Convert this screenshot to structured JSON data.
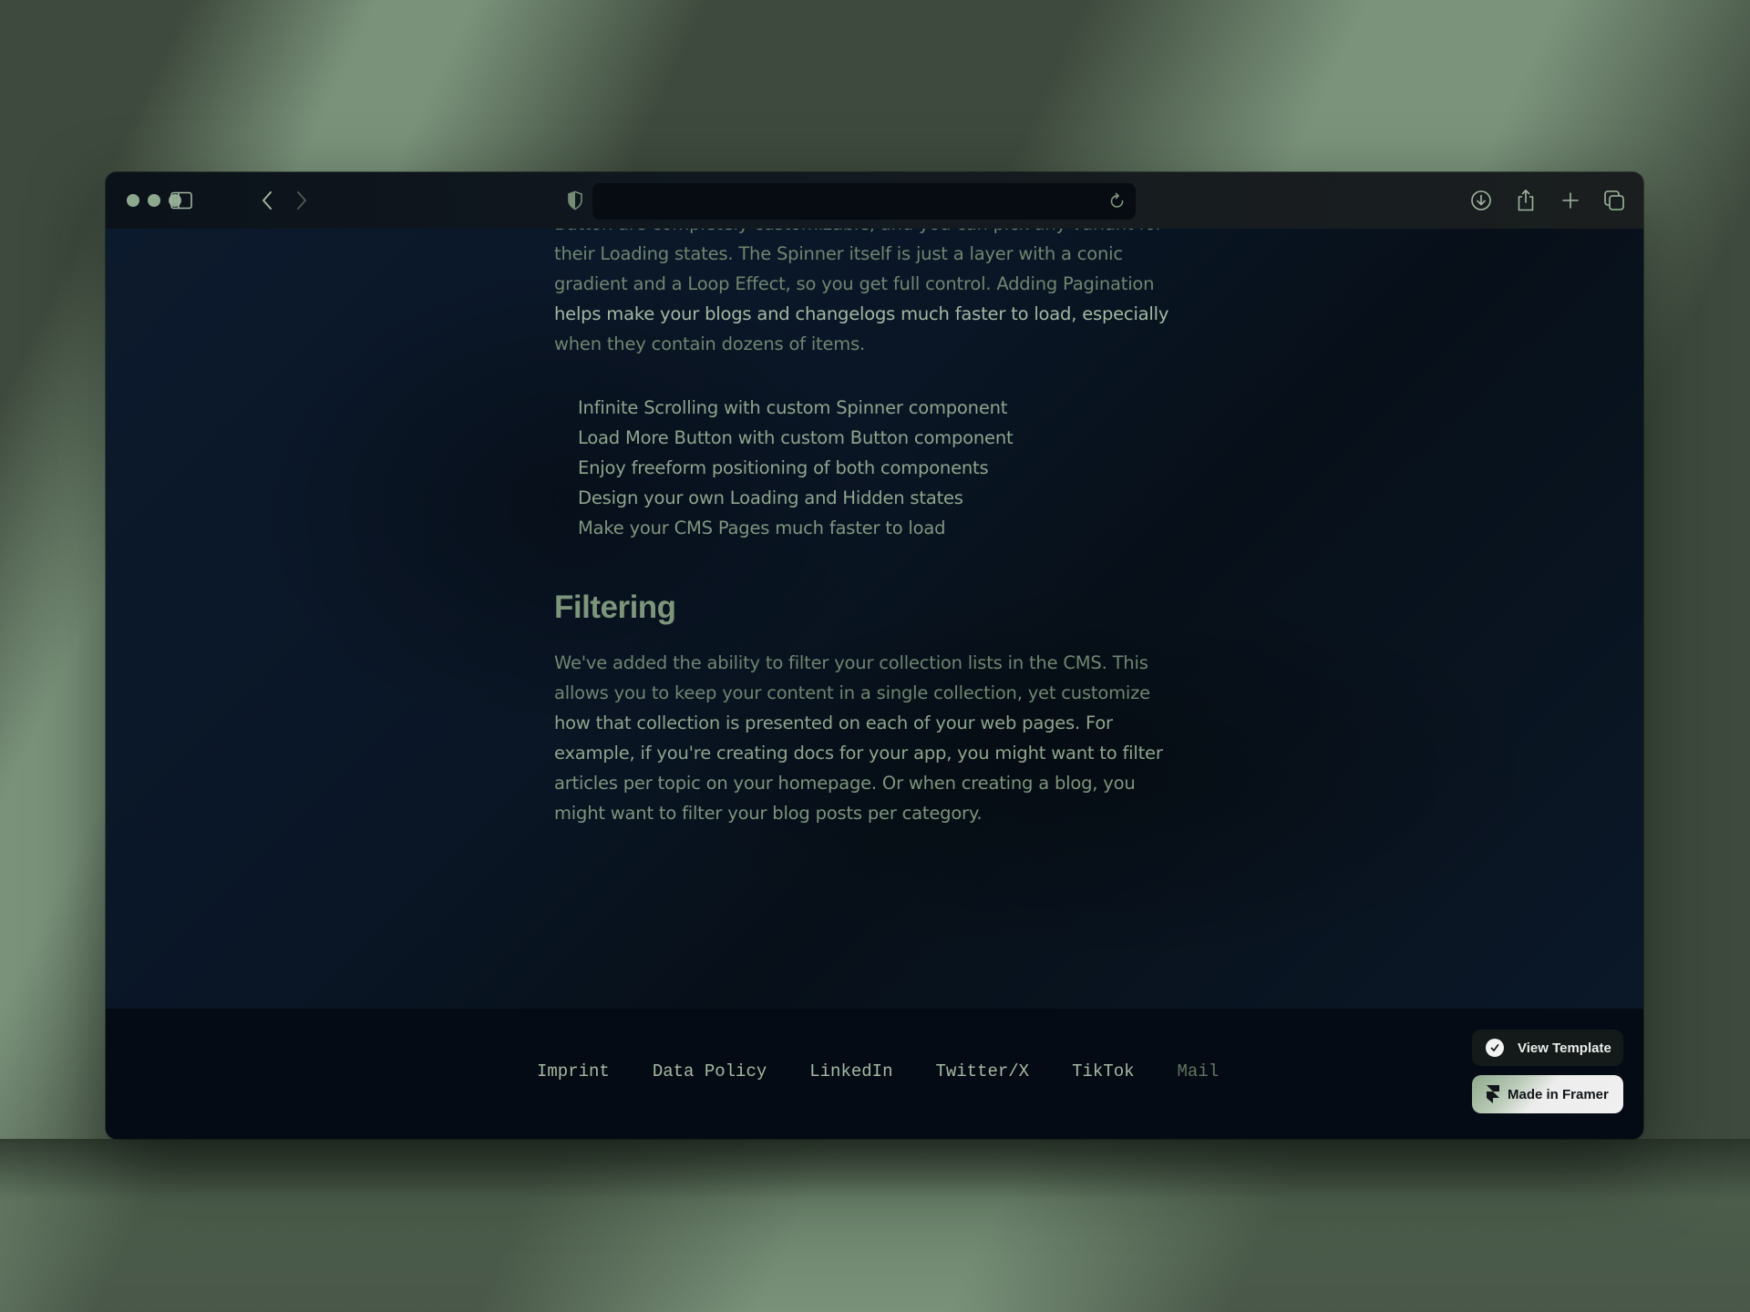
{
  "browser": {
    "toolbar_icons": [
      "sidebar-icon",
      "back-icon",
      "forward-icon",
      "shield-icon",
      "reload-icon",
      "download-icon",
      "share-icon",
      "new-tab-icon",
      "tabs-overview-icon"
    ],
    "colors": {
      "icon": "#9fb69e",
      "icon_disabled": "#4a5a4b",
      "traffic_light": "#8ea88e"
    }
  },
  "article": {
    "intro_paragraph": {
      "lines": [
        "Button are completely customizable, and you can pick any variant for",
        "their Loading states. The Spinner itself is just a layer with a conic",
        "gradient and a Loop Effect, so you get full control. Adding Pagination",
        "helps make your blogs and changelogs much faster to load, especially",
        "when they contain dozens of items."
      ]
    },
    "bullets": [
      "Infinite Scrolling with custom Spinner component",
      "Load More Button with custom Button component",
      "Enjoy freeform positioning of both components",
      "Design your own Loading and Hidden states",
      "Make your CMS Pages much faster to load"
    ],
    "section_heading": "Filtering",
    "filtering_paragraph": {
      "lines": [
        "We've added the ability to filter your collection lists in the CMS. This",
        "allows you to keep your content in a single collection, yet customize",
        "how that collection is presented on each of your web pages. For",
        "example, if you're creating docs for your app, you might want to filter",
        "articles per topic on your homepage. Or when creating a blog, you",
        "might want to filter your blog posts per category."
      ]
    }
  },
  "footer": {
    "links": [
      "Imprint",
      "Data Policy",
      "LinkedIn",
      "Twitter/X",
      "TikTok",
      "Mail"
    ],
    "view_template_label": "View Template",
    "made_in_framer_label": "Made in Framer"
  },
  "colors": {
    "background_dark": "#3e4a3d",
    "background_light": "#7a927a",
    "page_bg": "#0a1524",
    "footer_bg": "#050b14",
    "text_dim": "#6f8670",
    "text_bright": "#a3b9a2",
    "heading": "#7c957b"
  }
}
